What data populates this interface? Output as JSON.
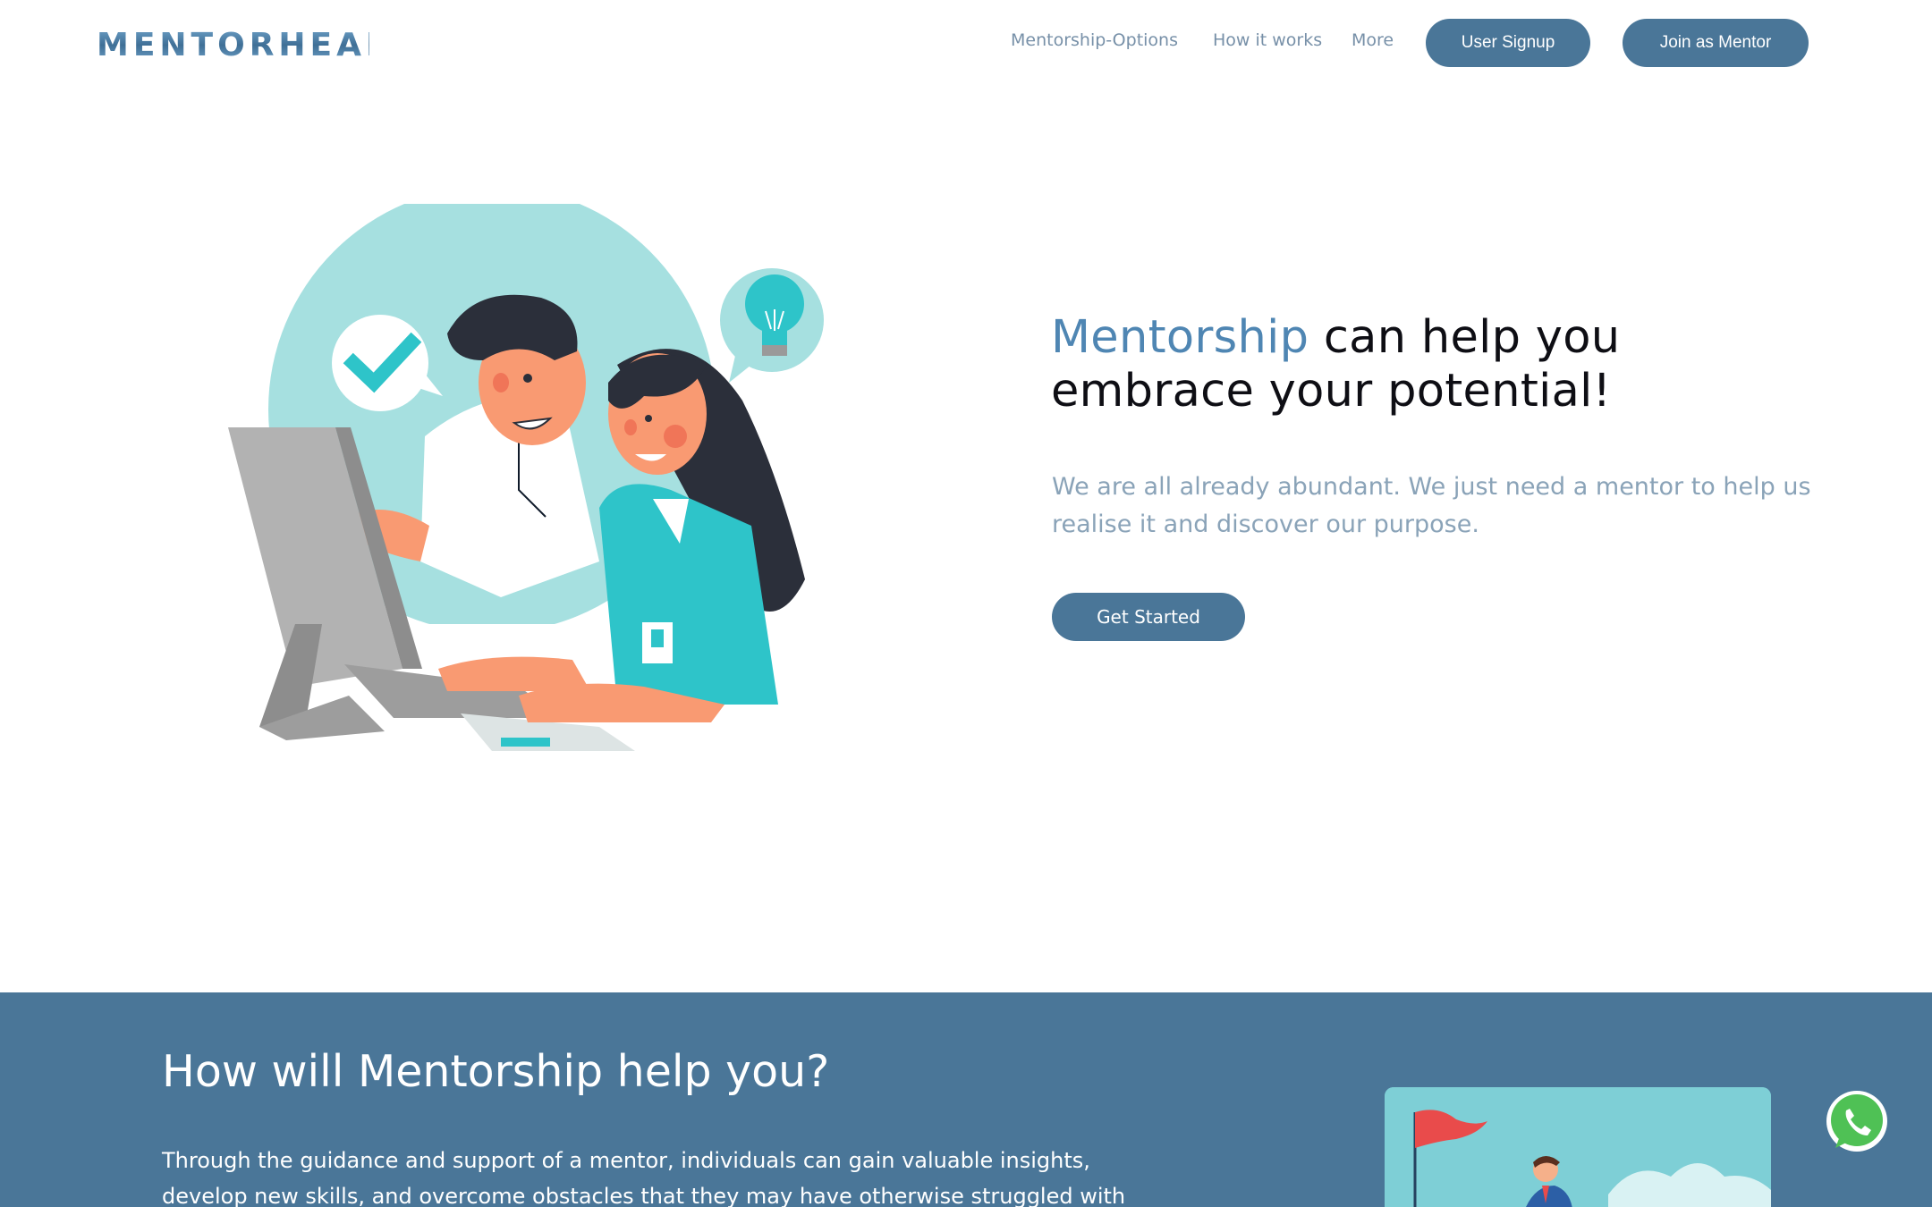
{
  "brand": {
    "logo_text": "MENTORHEAL"
  },
  "nav": {
    "links": [
      {
        "label": "Mentorship-Options"
      },
      {
        "label": "How it works"
      },
      {
        "label": "More"
      }
    ],
    "user_signup_label": "User Signup",
    "join_mentor_label": "Join as Mentor"
  },
  "hero": {
    "title_accent": "Mentorship",
    "title_rest": " can help you embrace your potential!",
    "subtitle": "We are all already abundant. We just need a mentor to help us realise it and discover our purpose.",
    "cta_label": "Get Started"
  },
  "help_section": {
    "title": "How will Mentorship help you?",
    "text": "Through the guidance and support of a mentor, individuals can gain valuable insights, develop new skills, and overcome obstacles that they may have otherwise struggled with"
  },
  "colors": {
    "accent": "#4a7698",
    "accent_text": "#4f86b3",
    "muted_text": "#8aa3b8",
    "illustration_teal": "#a6e0e0",
    "whatsapp_green": "#4fc155"
  },
  "icons": [
    "checkmark-icon",
    "lightbulb-icon",
    "whatsapp-icon",
    "flag-icon"
  ]
}
